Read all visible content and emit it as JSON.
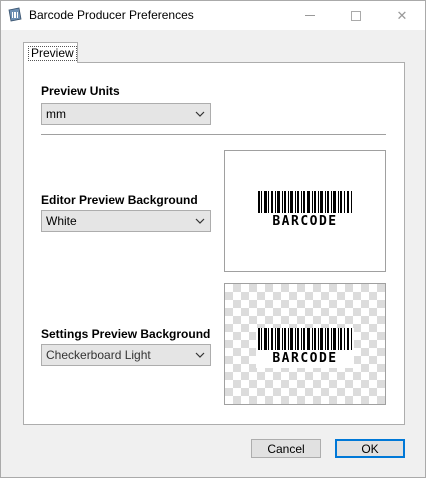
{
  "window": {
    "title": "Barcode Producer Preferences",
    "app_icon": "barcode-app-icon",
    "controls": {
      "minimize": "minimize-icon",
      "maximize": "maximize-icon",
      "close": "close-icon",
      "close_glyph": "✕"
    }
  },
  "tabs": [
    {
      "label": "Preview",
      "selected": true
    }
  ],
  "preview_units": {
    "label": "Preview Units",
    "value": "mm"
  },
  "editor_background": {
    "label": "Editor Preview Background",
    "value": "White",
    "sample_text": "BARCODE"
  },
  "settings_background": {
    "label": "Settings Preview Background",
    "value": "Checkerboard Light",
    "sample_text": "BARCODE"
  },
  "buttons": {
    "cancel": "Cancel",
    "ok": "OK"
  },
  "colors": {
    "accent": "#0078d7",
    "checker": "#dcdcdc"
  }
}
